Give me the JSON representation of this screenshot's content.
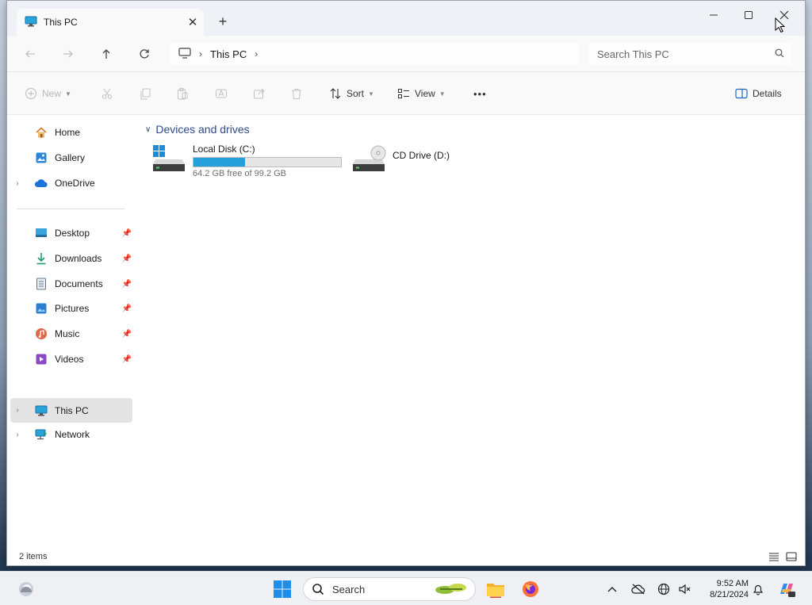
{
  "window": {
    "tab_title": "This PC",
    "tab_close": "✕",
    "new_tab": "+",
    "minimize": "—",
    "maximize": "☐",
    "close": "✕"
  },
  "address": {
    "crumb": "This PC",
    "search_placeholder": "Search This PC"
  },
  "toolbar": {
    "new_label": "New",
    "sort_label": "Sort",
    "view_label": "View",
    "more_label": "•••",
    "details_label": "Details"
  },
  "sidebar": {
    "items": [
      {
        "label": "Home"
      },
      {
        "label": "Gallery"
      },
      {
        "label": "OneDrive"
      },
      {
        "label": "Desktop"
      },
      {
        "label": "Downloads"
      },
      {
        "label": "Documents"
      },
      {
        "label": "Pictures"
      },
      {
        "label": "Music"
      },
      {
        "label": "Videos"
      },
      {
        "label": "This PC"
      },
      {
        "label": "Network"
      }
    ]
  },
  "content": {
    "group_title": "Devices and drives",
    "drives": [
      {
        "name": "Local Disk (C:)",
        "free_text": "64.2 GB free of 99.2 GB",
        "used_fraction": 0.35
      },
      {
        "name": "CD Drive (D:)"
      }
    ]
  },
  "status": {
    "item_count": "2 items"
  },
  "taskbar": {
    "search_label": "Search",
    "time": "9:52 AM",
    "date": "8/21/2024"
  },
  "colors": {
    "accent": "#26a0da",
    "group_header": "#2d4b8a",
    "selected_bg": "#e3e3e3"
  }
}
